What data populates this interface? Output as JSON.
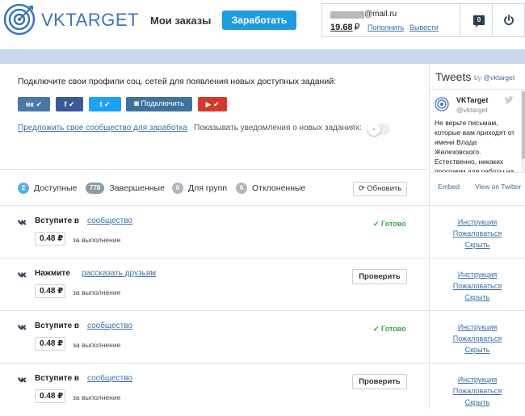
{
  "header": {
    "logo_text": "VKTARGET",
    "nav_orders": "Мои заказы",
    "earn_button": "Заработать",
    "account": {
      "email_suffix": "@mail.ru",
      "balance": "19.68",
      "currency": "₽",
      "refill": "Пополнить",
      "withdraw": "Вывести"
    },
    "messages_count": "0"
  },
  "profiles": {
    "title": "Подключите свои профили соц. сетей для появления новых доступных заданий:",
    "buttons": {
      "vk": "вк",
      "fb": "f",
      "tw": "t",
      "ig": "Подключить",
      "yt": "▶"
    },
    "suggest_link": "Предложить свое сообщество для заработка",
    "notify_label": "Показывать уведомления о новых заданиях:"
  },
  "tweets": {
    "title": "Tweets",
    "by": "by",
    "handle_link": "@vktarget",
    "tweet": {
      "name": "VKTarget",
      "handle": "@vktarget",
      "text": "Не верьте письмам, которые вам приходят от имени Влада Железовского. Естественно, никаких программ для работы на"
    },
    "embed": "Embed",
    "view": "View on Twitter"
  },
  "tabs": [
    {
      "count": "2",
      "label": "Доступные"
    },
    {
      "count": "778",
      "label": "Завершенные"
    },
    {
      "count": "0",
      "label": "Для групп"
    },
    {
      "count": "6",
      "label": "Отклоненные"
    }
  ],
  "refresh_button": "Обновить",
  "tasks": [
    {
      "action": "Вступите в",
      "object": "сообщество",
      "price": "0.48 ₽",
      "per": "за выполнение",
      "state": "✔ Готово"
    },
    {
      "action": "Нажмите",
      "object": "рассказать друзьям",
      "price": "0.48 ₽",
      "per": "за выполнение",
      "state": "Проверить"
    },
    {
      "action": "Вступите в",
      "object": "сообщество",
      "price": "0.48 ₽",
      "per": "за выполнение",
      "state": "✔ Готово"
    },
    {
      "action": "Вступите в",
      "object": "сообщество",
      "price": "0.48 ₽",
      "per": "за выполнение",
      "state": "Проверить"
    }
  ],
  "side_links": {
    "instruction": "Инструкция",
    "complain": "Пожаловаться",
    "hide": "Скрыть"
  }
}
